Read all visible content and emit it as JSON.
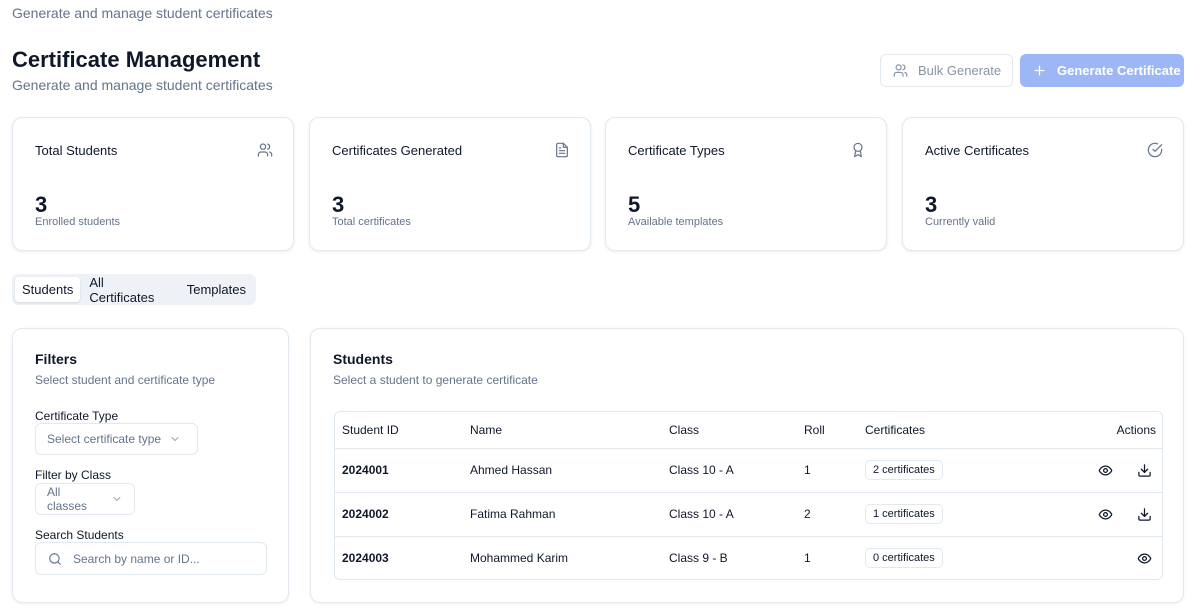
{
  "header": {
    "top_subtitle": "Generate and manage student certificates",
    "title": "Certificate Management",
    "subtitle": "Generate and manage student certificates",
    "bulk_button": "Bulk Generate",
    "generate_button": "Generate Certificate",
    "generate_button_color": "#9db6f5"
  },
  "stats": [
    {
      "title": "Total Students",
      "value": "3",
      "caption": "Enrolled students",
      "icon": "users-icon"
    },
    {
      "title": "Certificates Generated",
      "value": "3",
      "caption": "Total certificates",
      "icon": "file-text-icon"
    },
    {
      "title": "Certificate Types",
      "value": "5",
      "caption": "Available templates",
      "icon": "award-icon"
    },
    {
      "title": "Active Certificates",
      "value": "3",
      "caption": "Currently valid",
      "icon": "check-circle-icon"
    }
  ],
  "tabs": [
    {
      "label": "Students",
      "active": true
    },
    {
      "label": "All Certificates",
      "active": false
    },
    {
      "label": "Templates",
      "active": false
    }
  ],
  "filters": {
    "title": "Filters",
    "subtitle": "Select student and certificate type",
    "cert_type_label": "Certificate Type",
    "cert_type_placeholder": "Select certificate type",
    "class_label": "Filter by Class",
    "class_value": "All classes",
    "search_label": "Search Students",
    "search_placeholder": "Search by name or ID..."
  },
  "students": {
    "title": "Students",
    "subtitle": "Select a student to generate certificate",
    "columns": [
      "Student ID",
      "Name",
      "Class",
      "Roll",
      "Certificates",
      "Actions"
    ],
    "rows": [
      {
        "id": "2024001",
        "name": "Ahmed Hassan",
        "class": "Class 10 - A",
        "roll": "1",
        "certificates": "2 certificates",
        "actions": [
          "eye-icon",
          "download-icon"
        ]
      },
      {
        "id": "2024002",
        "name": "Fatima Rahman",
        "class": "Class 10 - A",
        "roll": "2",
        "certificates": "1 certificates",
        "actions": [
          "eye-icon",
          "download-icon"
        ]
      },
      {
        "id": "2024003",
        "name": "Mohammed Karim",
        "class": "Class 9 - B",
        "roll": "1",
        "certificates": "0 certificates",
        "actions": [
          "eye-icon"
        ]
      }
    ]
  }
}
